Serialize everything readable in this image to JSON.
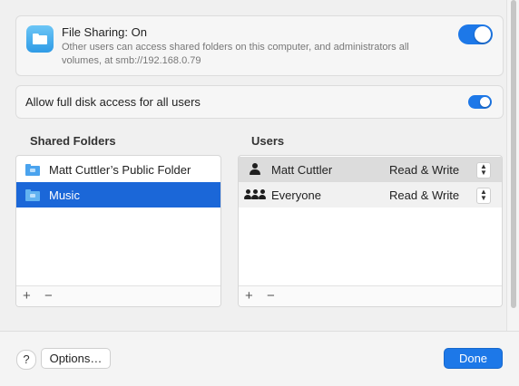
{
  "file_sharing": {
    "title": "File Sharing: On",
    "subtitle": "Other users can access shared folders on this computer, and administrators all volumes, at smb://192.168.0.79",
    "enabled": true
  },
  "full_disk_access": {
    "label": "Allow full disk access for all users",
    "enabled": true
  },
  "shared_folders": {
    "heading": "Shared Folders",
    "items": [
      {
        "label": "Matt Cuttler’s Public Folder",
        "selected": false
      },
      {
        "label": "Music",
        "selected": true
      }
    ]
  },
  "users": {
    "heading": "Users",
    "items": [
      {
        "label": "Matt Cuttler",
        "permission": "Read & Write",
        "icon": "person-icon"
      },
      {
        "label": "Everyone",
        "permission": "Read & Write",
        "icon": "group-icon"
      }
    ]
  },
  "toolbar": {
    "add": "+",
    "remove": "−"
  },
  "footer": {
    "help": "?",
    "options": "Options…",
    "done": "Done"
  },
  "colors": {
    "accent": "#1d78e8",
    "selection": "#1b67d8"
  }
}
